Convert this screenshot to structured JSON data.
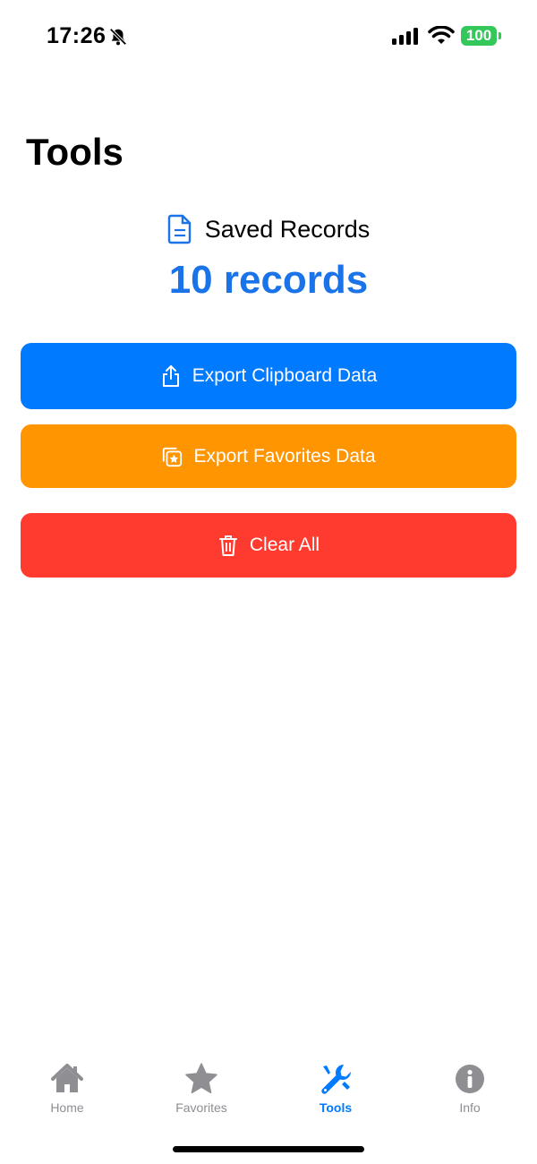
{
  "status_bar": {
    "time": "17:26",
    "battery": "100",
    "icons": [
      "bell-slash-icon",
      "signal-icon",
      "wifi-icon",
      "battery-icon"
    ]
  },
  "page": {
    "title": "Tools"
  },
  "summary": {
    "icon": "document-icon",
    "label": "Saved Records",
    "count": "10 records",
    "count_color": "#1a73e8"
  },
  "actions": {
    "export_clipboard": {
      "label": "Export Clipboard Data",
      "icon": "share-icon",
      "color": "#007aff"
    },
    "export_favorites": {
      "label": "Export Favorites Data",
      "icon": "star-stack-icon",
      "color": "#ff9500"
    },
    "clear_all": {
      "label": "Clear All",
      "icon": "trash-icon",
      "color": "#ff3b30"
    }
  },
  "tab_bar": {
    "active": "Tools",
    "items": [
      {
        "label": "Home",
        "icon": "house-icon"
      },
      {
        "label": "Favorites",
        "icon": "star-icon"
      },
      {
        "label": "Tools",
        "icon": "wrench-icon"
      },
      {
        "label": "Info",
        "icon": "info-icon"
      }
    ]
  }
}
